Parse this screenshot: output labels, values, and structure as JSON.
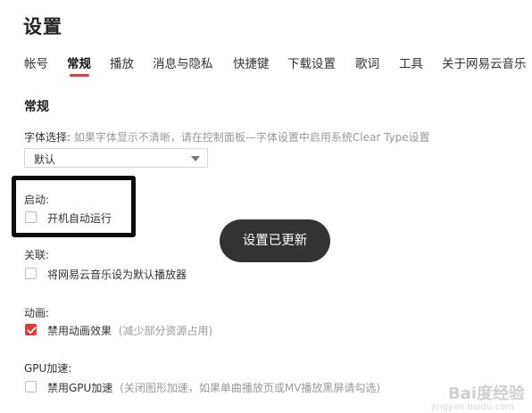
{
  "page": {
    "title": "设置"
  },
  "tabs": [
    {
      "label": "帐号"
    },
    {
      "label": "常规",
      "active": true
    },
    {
      "label": "播放"
    },
    {
      "label": "消息与隐私"
    },
    {
      "label": "快捷键"
    },
    {
      "label": "下载设置"
    },
    {
      "label": "歌词"
    },
    {
      "label": "工具"
    },
    {
      "label": "关于网易云音乐"
    }
  ],
  "section": {
    "title": "常规"
  },
  "font": {
    "label": "字体选择:",
    "hint": "如果字体显示不清晰，请在控制面板—字体设置中启用系统Clear Type设置",
    "selected": "默认"
  },
  "startup": {
    "label": "启动:",
    "option": "开机自动运行",
    "checked": false
  },
  "association": {
    "label": "关联:",
    "option": "将网易云音乐设为默认播放器",
    "checked": false
  },
  "animation": {
    "label": "动画:",
    "option": "禁用动画效果",
    "hint": "(减少部分资源占用)",
    "checked": true
  },
  "gpu": {
    "label": "GPU加速:",
    "option": "禁用GPU加速",
    "hint": "(关闭图形加速，如果单曲播放页或MV播放黑屏请勾选)",
    "checked": false
  },
  "toast": {
    "text": "设置已更新"
  },
  "watermark": {
    "text": "Bai度经验",
    "sub": "jingyan.baidu.com"
  },
  "colors": {
    "accent": "#e03a3a",
    "toast_bg": "#333333",
    "hint_text": "#999999"
  }
}
